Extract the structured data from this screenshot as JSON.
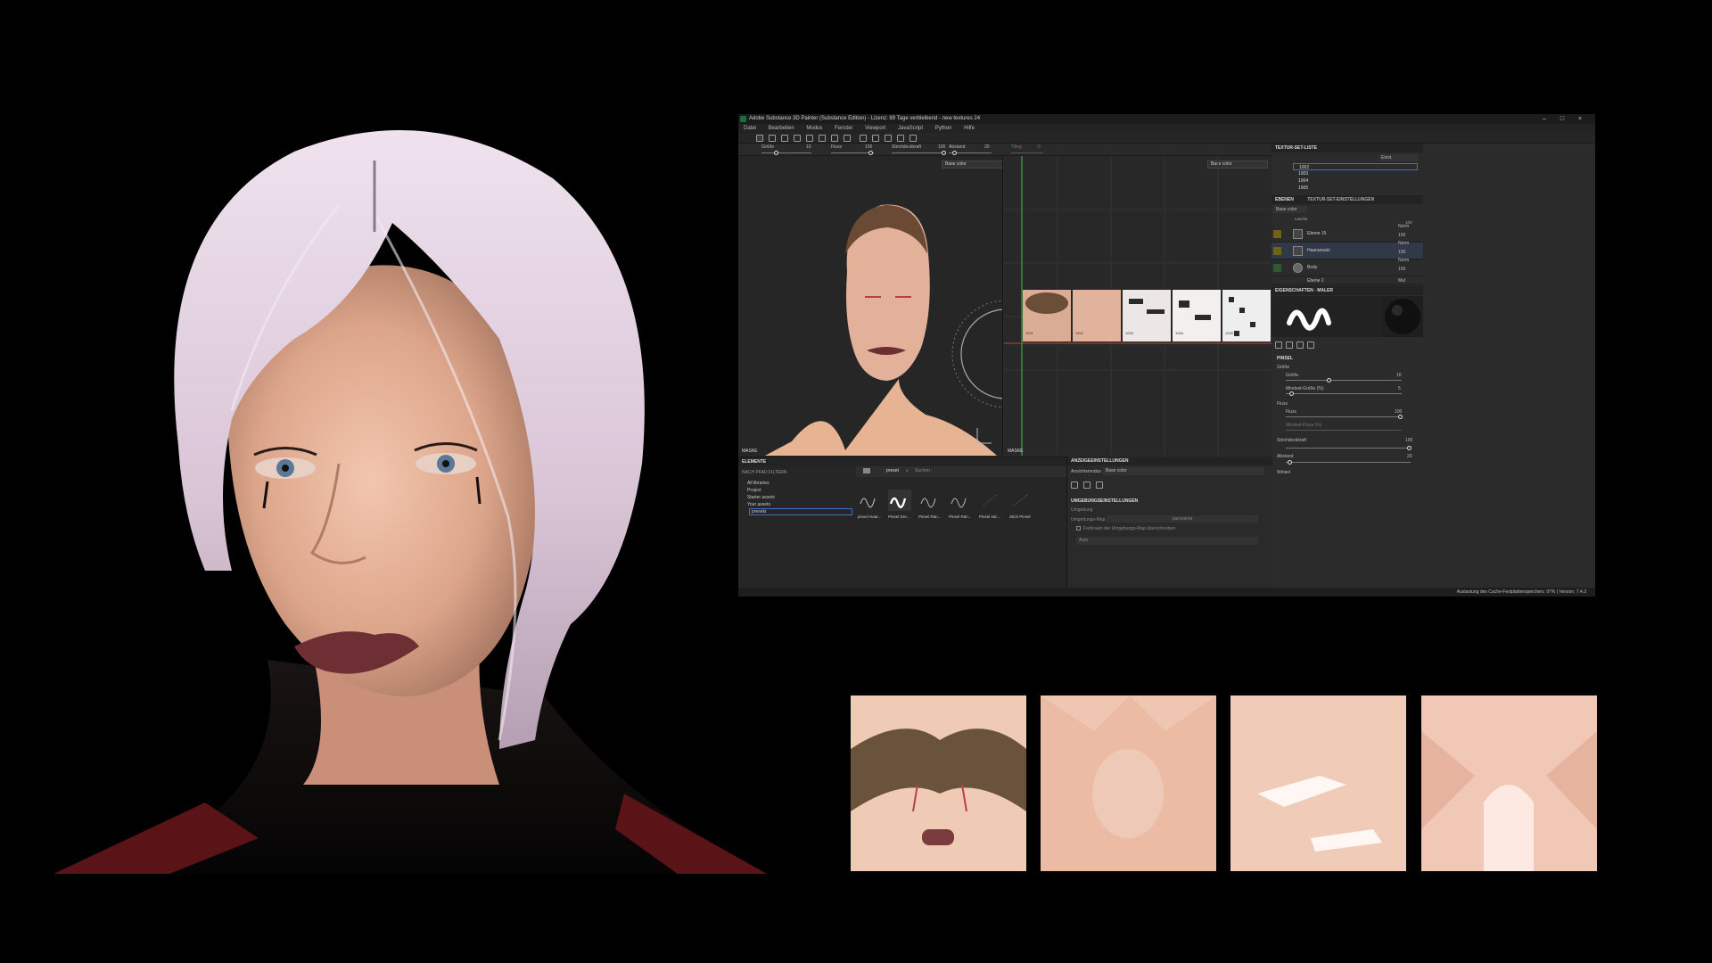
{
  "window": {
    "title": "Adobe Substance 3D Painter (Substance Edition) - Lizenz: 89 Tage verbleibend - new textures 24",
    "minimize": "–",
    "maximize": "□",
    "close": "×"
  },
  "menu": [
    "Datei",
    "Bearbeiten",
    "Modus",
    "Fenster",
    "Viewport",
    "JavaScript",
    "Python",
    "Hilfe"
  ],
  "brush_toolbar": {
    "size_label": "Größe",
    "size_value": "10",
    "flow_label": "Fluss",
    "flow_value": "100",
    "stroke_label": "Strichdeckkraft",
    "stroke_value": "100",
    "spacing_label": "Abstand",
    "spacing_value": "20",
    "tiling_label": "Tiling",
    "tiling_value": "0"
  },
  "viewport_3d": {
    "channel": "Base color",
    "mask_label": "MASKE"
  },
  "viewport_2d": {
    "channel": "Base color",
    "mask_label": "MASKE"
  },
  "uv_tiles": [
    "1001",
    "1002",
    "1003",
    "1004",
    "1005"
  ],
  "texture_set_list": {
    "title": "TEXTUR-SET-LISTE",
    "dropdown": "Einst.",
    "items": [
      "1002",
      "1003",
      "1004",
      "1005"
    ]
  },
  "layers_panel": {
    "tab_layers": "EBENEN",
    "tab_settings": "TEXTUR-SET-EINSTELLUNGEN",
    "channel": "Base color",
    "top_row": {
      "name": "Lasche",
      "value": "100"
    },
    "rows": [
      {
        "name": "Ebene 15",
        "blend": "Norm",
        "opacity": "100"
      },
      {
        "name": "Haaransatz",
        "blend": "Norm",
        "opacity": "100"
      },
      {
        "name": "Body",
        "blend": "Norm",
        "opacity": "100"
      },
      {
        "name": "Ebene 2",
        "blend": "Mul",
        "opacity": ""
      }
    ]
  },
  "properties": {
    "title": "EIGENSCHAFTEN - MALER",
    "section": "PINSEL",
    "size_label": "Größe",
    "size_sub": "Größe",
    "size_value": "10",
    "min_size_label": "Mindest-Größe (%)",
    "min_size_value": "5",
    "flow_label": "Fluss",
    "flow_sub": "Fluss",
    "flow_value": "100",
    "min_flow_label": "Mindest-Fluss (%)",
    "stroke_label": "Strichdeckkraft",
    "stroke_value": "100",
    "spacing_label": "Abstand",
    "spacing_value": "20",
    "angle_label": "Winkel"
  },
  "elements_panel": {
    "title": "ELEMENTE",
    "filter_label": "NACH PFAD FILTERN",
    "tree": [
      "All libraries",
      "Project",
      "Starter assets",
      "Your assets",
      "presets"
    ],
    "path": "preset",
    "search_placeholder": "Suchen",
    "brushes": [
      "pinsel Haar...",
      "Pinsel Dre...",
      "Pinsel Rän...",
      "Pinsel Rän...",
      "Pinsel stic...",
      "Stich Pinsel"
    ]
  },
  "display_settings": {
    "title": "ANZEIGEEINSTELLUNGEN",
    "view_mode_label": "Ansichtsmodus",
    "view_mode_value": "Base color",
    "env_title": "UMGEBUNGSEINSTELLUNGEN",
    "env_label": "Umgebung",
    "env_map_label": "Umgebungs-Map",
    "env_map_value": "panorama",
    "fallback_label": "Farbraum der Umgebungs-Map überschreiben",
    "auto_label": "Auto"
  },
  "status": {
    "text": "Auslastung des Cache-Festplattenspeichers:  97% | Version: 7.4.3"
  },
  "colors": {
    "app_bg": "#2b2b2b",
    "accent_layer": "#6f6318",
    "selected_blue": "#3a72c9"
  }
}
